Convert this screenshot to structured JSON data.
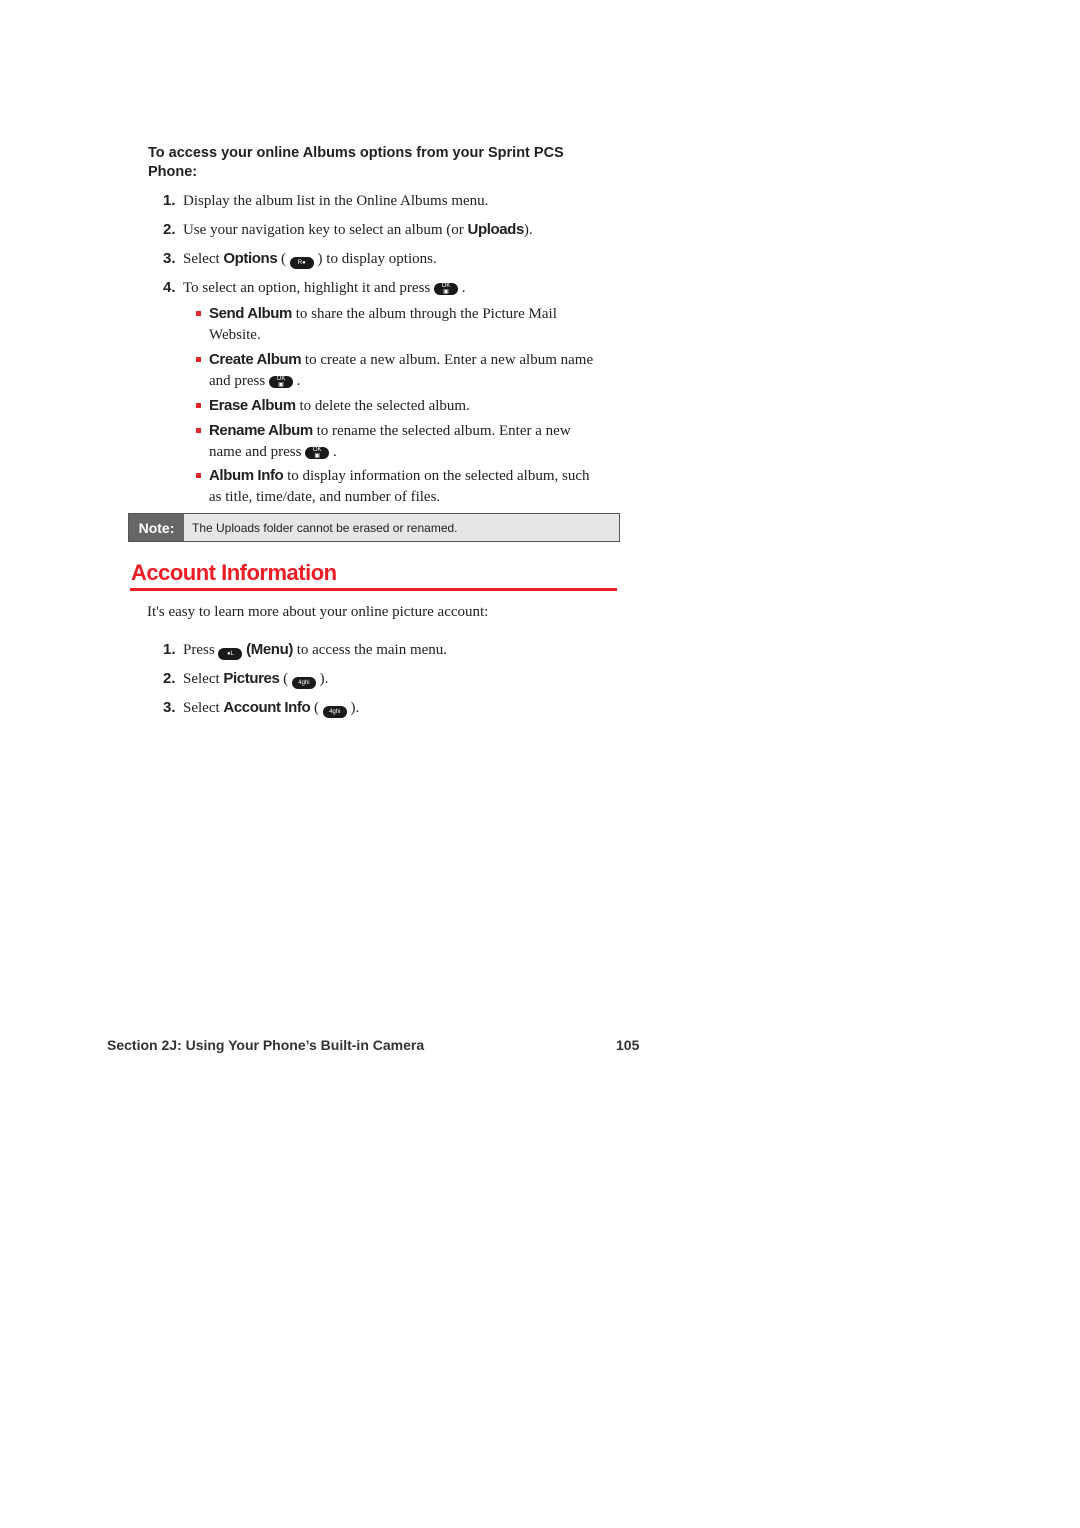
{
  "intro": "To access your online Albums options from your Sprint PCS Phone:",
  "steps1": [
    {
      "num": "1.",
      "pre": "Display the album list in the Online Albums menu.",
      "bold": "",
      "post": ""
    },
    {
      "num": "2.",
      "pre": "Use your navigation key to select an album (or ",
      "bold": "Uploads",
      "post": ")."
    },
    {
      "num": "3.",
      "pre": "Select ",
      "bold": "Options",
      "post": " to display options.",
      "key": "Right softkey",
      "key_label": "Rsoft"
    },
    {
      "num": "4.",
      "pre": "To select an option, highlight it and press ",
      "bold": "",
      "post": ".",
      "key": "OK key",
      "key_label": "OK"
    }
  ],
  "options": [
    {
      "bold": "Send Album",
      "text": " to share the album through the Picture Mail Website."
    },
    {
      "bold": "Create Album",
      "text": " to create a new album. Enter a new album name and press",
      "key_label": "OK",
      "end": " ."
    },
    {
      "bold": "Erase Album",
      "text": " to delete the selected album."
    },
    {
      "bold": "Rename Album",
      "text": " to rename the selected album. Enter a new name and press",
      "key_label": "OK",
      "end": " ."
    },
    {
      "bold": "Album Info",
      "text": " to display information on the selected album, such as title, time/date, and number of files."
    }
  ],
  "note": {
    "label": "Note:",
    "text": "The Uploads folder cannot be erased or renamed."
  },
  "section": {
    "heading": "Account Information",
    "intro": "It's easy to learn more about your online picture account:",
    "steps": [
      {
        "num": "1.",
        "pre": "Press ",
        "key_label": "Lsoft",
        "bold": "(Menu)",
        "post": " to access the main menu."
      },
      {
        "num": "2.",
        "pre": "Select ",
        "bold": "Pictures",
        "key_label": "4 GHI",
        "post": ")."
      },
      {
        "num": "3.",
        "pre": "Select ",
        "bold": "Account Info",
        "key_label": "4 GHI",
        "post": ")."
      }
    ]
  },
  "footer": {
    "section": "Section 2J: Using Your Phone’s Built-in Camera",
    "page": "105"
  },
  "colors": {
    "accent": "#ee1c24",
    "note_label_bg": "#666666",
    "note_bg": "#e6e6e6"
  }
}
